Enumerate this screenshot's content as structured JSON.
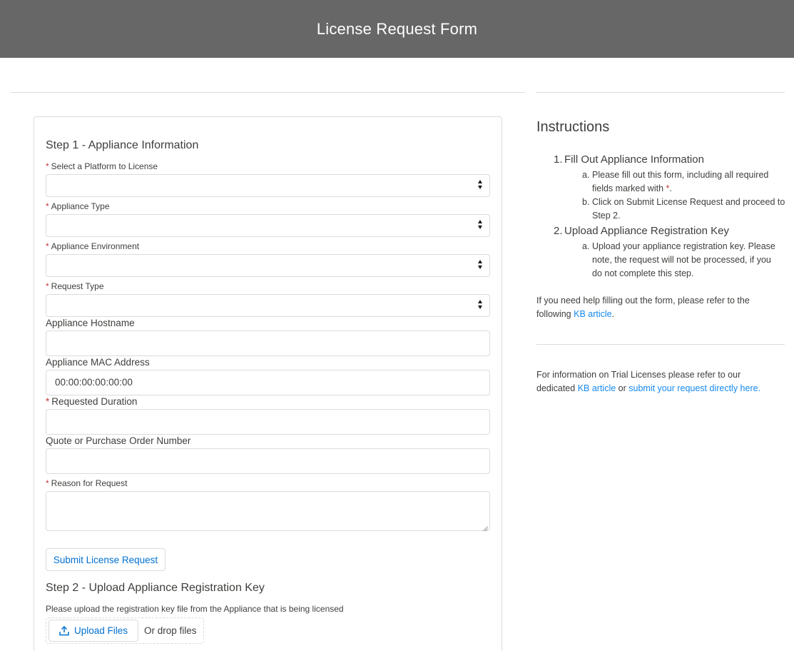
{
  "header": {
    "title": "License Request Form"
  },
  "form": {
    "step1_title": "Step 1 - Appliance Information",
    "required_marker": "*",
    "platform_label": "Select a Platform to License",
    "appliance_type_label": "Appliance Type",
    "environment_label": "Appliance Environment",
    "request_type_label": "Request Type",
    "hostname_label": "Appliance Hostname",
    "hostname_value": "",
    "mac_label": "Appliance MAC Address",
    "mac_placeholder": "00:00:00:00:00:00",
    "duration_label": "Requested Duration",
    "duration_value": "",
    "po_label": "Quote or Purchase Order Number",
    "po_value": "",
    "reason_label": "Reason for Request",
    "submit_label": "Submit License Request",
    "step2_title": "Step 2 - Upload Appliance Registration Key",
    "upload_help": "Please upload the registration key file from the Appliance that is being licensed",
    "upload_button": "Upload Files",
    "drop_text": "Or drop files"
  },
  "instructions": {
    "title": "Instructions",
    "item1_num": "1.",
    "item1": "Fill Out Appliance Information",
    "item1a_letter": "a.",
    "item1a_line1": "Please fill out this form, including all required",
    "item1a_line2": "fields marked with",
    "item1a_star": "*",
    "item1a_end": ".",
    "item1b_letter": "b.",
    "item1b_line1": "Click on Submit License Request and proceed to",
    "item1b_line2": "Step 2.",
    "item2_num": "2.",
    "item2": "Upload Appliance Registration Key",
    "item2a_letter": "a.",
    "item2a_line1": "Upload your appliance registration key. Please",
    "item2a_line2": "note, the request will not be processed, if you",
    "item2a_line3": "do not complete this step.",
    "help_line1": "If you need help filling out the form, please refer to the",
    "help_line2_pre": "following ",
    "help_link": "KB article",
    "help_line2_end": ".",
    "trial_line1": "For information on Trial Licenses please refer to our",
    "trial_line2_pre": "dedicated ",
    "trial_link1": "KB article",
    "trial_mid": " or ",
    "trial_link2": "submit your request directly here."
  },
  "colors": {
    "header_bg": "#676767",
    "link": "#1589ee",
    "required": "#c23934",
    "button_text": "#0070d2"
  }
}
